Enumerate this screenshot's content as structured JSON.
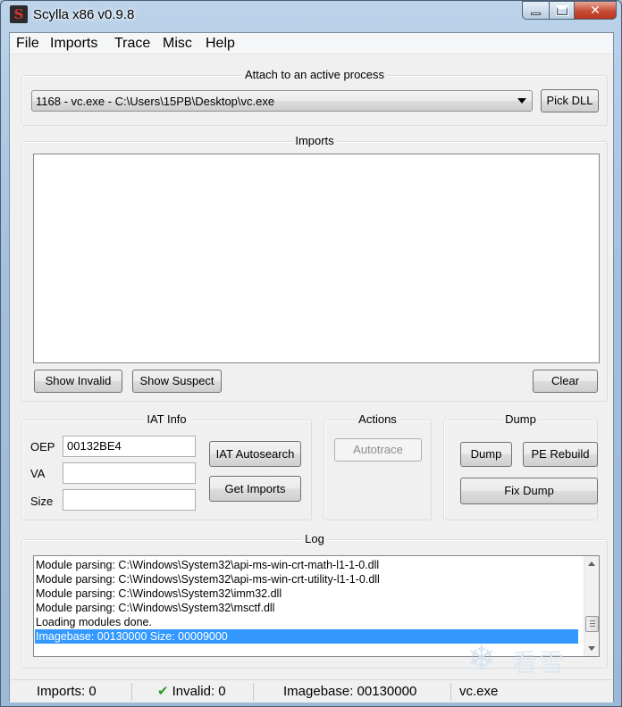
{
  "window": {
    "title": "Scylla x86 v0.9.8",
    "icon_letter": "S"
  },
  "menu": [
    "File",
    "Imports",
    "Trace",
    "Misc",
    "Help"
  ],
  "attach": {
    "group_title": "Attach to an active process",
    "selected_process": "1168 - vc.exe - C:\\Users\\15PB\\Desktop\\vc.exe",
    "pick_dll_label": "Pick DLL"
  },
  "imports": {
    "group_title": "Imports",
    "show_invalid_label": "Show Invalid",
    "show_suspect_label": "Show Suspect",
    "clear_label": "Clear"
  },
  "iat_info": {
    "group_title": "IAT Info",
    "oep_label": "OEP",
    "oep_value": "00132BE4",
    "va_label": "VA",
    "va_value": "",
    "size_label": "Size",
    "size_value": "",
    "autosearch_label": "IAT Autosearch",
    "get_imports_label": "Get Imports"
  },
  "actions": {
    "group_title": "Actions",
    "autotrace_label": "Autotrace"
  },
  "dump": {
    "group_title": "Dump",
    "dump_label": "Dump",
    "pe_rebuild_label": "PE Rebuild",
    "fix_dump_label": "Fix Dump"
  },
  "log": {
    "group_title": "Log",
    "lines": [
      "Module parsing: C:\\Windows\\System32\\api-ms-win-crt-math-l1-1-0.dll",
      "Module parsing: C:\\Windows\\System32\\api-ms-win-crt-utility-l1-1-0.dll",
      "Module parsing: C:\\Windows\\System32\\imm32.dll",
      "Module parsing: C:\\Windows\\System32\\msctf.dll",
      "Loading modules done.",
      "Imagebase: 00130000 Size: 00009000"
    ],
    "selected_index": 5
  },
  "status": {
    "imports": "Imports: 0",
    "invalid": "Invalid: 0",
    "imagebase": "Imagebase: 00130000",
    "module": "vc.exe"
  },
  "watermark": {
    "text": "看雪",
    "icon": "snowflake-icon"
  },
  "colors": {
    "selection": "#3399ff",
    "close_button": "#c84b33",
    "valid_check": "#2a9b2a"
  }
}
